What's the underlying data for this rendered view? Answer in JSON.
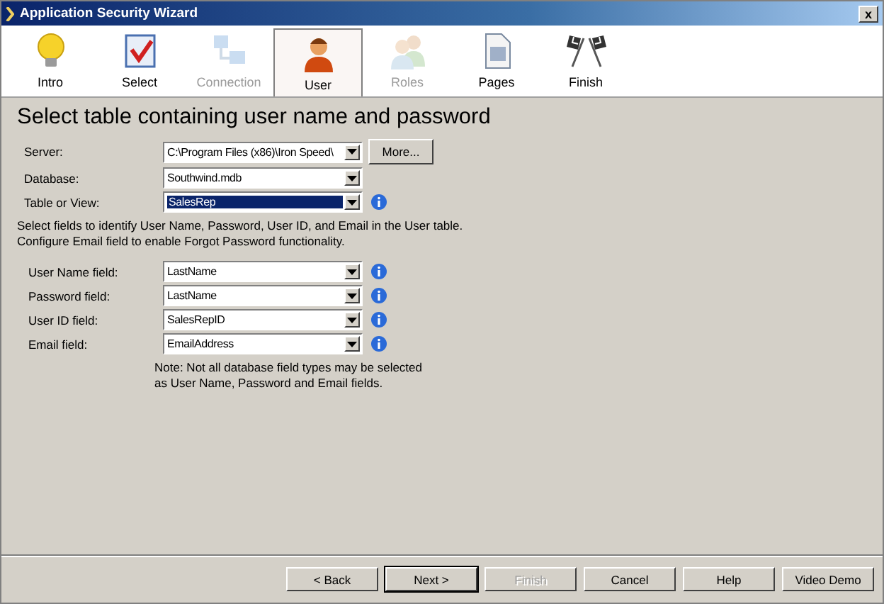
{
  "window": {
    "title": "Application Security Wizard",
    "close": "x"
  },
  "steps": [
    {
      "label": "Intro",
      "selected": false,
      "disabled": false
    },
    {
      "label": "Select",
      "selected": false,
      "disabled": false
    },
    {
      "label": "Connection",
      "selected": false,
      "disabled": true
    },
    {
      "label": "User",
      "selected": true,
      "disabled": false
    },
    {
      "label": "Roles",
      "selected": false,
      "disabled": true
    },
    {
      "label": "Pages",
      "selected": false,
      "disabled": false
    },
    {
      "label": "Finish",
      "selected": false,
      "disabled": false
    }
  ],
  "heading": "Select table containing user name and password",
  "source_fields": [
    {
      "label": "Server:",
      "value": "C:\\Program Files (x86)\\Iron Speed\\",
      "highlighted": false,
      "button": "More..."
    },
    {
      "label": "Database:",
      "value": "Southwind.mdb",
      "highlighted": false
    },
    {
      "label": "Table or View:",
      "value": "SalesRep",
      "highlighted": true,
      "info": true
    }
  ],
  "instructions": "Select fields to identify User Name, Password, User ID, and Email in the User table. Configure Email field to enable Forgot Password functionality.",
  "user_fields": [
    {
      "label": "User Name field:",
      "value": "LastName",
      "info": true
    },
    {
      "label": "Password field:",
      "value": "LastName",
      "info": true
    },
    {
      "label": "User ID field:",
      "value": "SalesRepID",
      "info": true
    },
    {
      "label": "Email field:",
      "value": "EmailAddress",
      "info": true
    }
  ],
  "note": "Note: Not all database field types may be selected as User Name, Password and Email fields.",
  "buttons": [
    {
      "label": "< Back",
      "disabled": false,
      "default": false
    },
    {
      "label": "Next >",
      "disabled": false,
      "default": true
    },
    {
      "label": "Finish",
      "disabled": true,
      "default": false
    },
    {
      "label": "Cancel",
      "disabled": false,
      "default": false
    },
    {
      "label": "Help",
      "disabled": false,
      "default": false
    },
    {
      "label": "Video Demo",
      "disabled": false,
      "default": false
    }
  ]
}
